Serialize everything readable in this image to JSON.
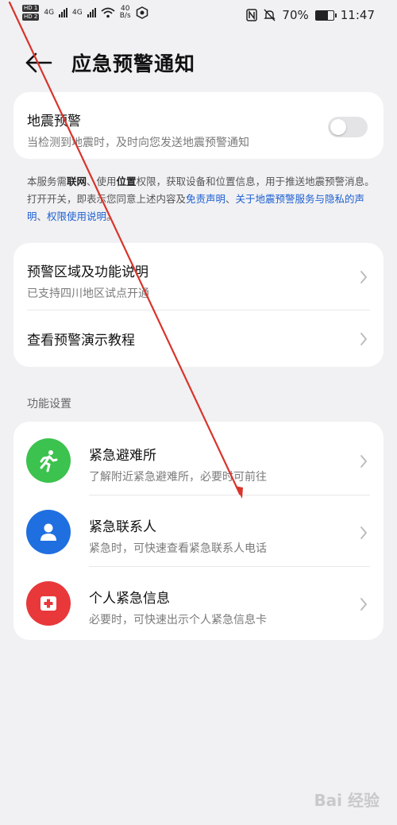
{
  "status_bar": {
    "hd1": "HD 1",
    "hd2": "HD 2",
    "net1": "4G",
    "net2": "4G",
    "speed_value": "40",
    "speed_unit": "B/s",
    "battery": "70%",
    "battery_level": 0.7,
    "time": "11:47"
  },
  "header": {
    "title": "应急预警通知"
  },
  "earthquake": {
    "title": "地震预警",
    "subtitle": "当检测到地震时，及时向您发送地震预警通知",
    "toggle_on": false
  },
  "notice": {
    "p1": "本服务需",
    "b1": "联网",
    "p2": "、使用",
    "b2": "位置",
    "p3": "权限，获取设备和位置信息，用于推送地震预警消息。打开开关，即表示您同意上述内容及",
    "link1": "免责声明",
    "sep1": "、",
    "link2": "关于地震预警服务与隐私的声明",
    "sep2": "、",
    "link3": "权限使用说明",
    "end": "。"
  },
  "region": {
    "row1_title": "预警区域及功能说明",
    "row1_sub": "已支持四川地区试点开通",
    "row2_title": "查看预警演示教程"
  },
  "section_label": "功能设置",
  "features": [
    {
      "title": "紧急避难所",
      "subtitle": "了解附近紧急避难所，必要时可前往",
      "icon": "running-person-icon",
      "color": "#3cc24e"
    },
    {
      "title": "紧急联系人",
      "subtitle": "紧急时，可快速查看紧急联系人电话",
      "icon": "person-icon",
      "color": "#1f6fe0"
    },
    {
      "title": "个人紧急信息",
      "subtitle": "必要时，可快速出示个人紧急信息卡",
      "icon": "medical-card-icon",
      "color": "#e8383a"
    }
  ],
  "watermark": "Bai 经验"
}
